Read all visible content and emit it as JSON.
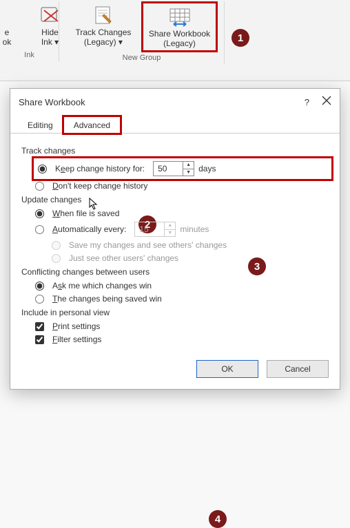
{
  "ribbon": {
    "groups": {
      "ink": {
        "label": "Ink",
        "btns": {
          "partial": {
            "line1": "e",
            "line2": "ok"
          },
          "hide_ink": {
            "line1": "Hide",
            "line2": "Ink ▾"
          }
        }
      },
      "newgroup": {
        "label": "New Group",
        "btns": {
          "track_changes": {
            "line1": "Track Changes",
            "line2": "(Legacy) ▾"
          },
          "share_wb": {
            "line1": "Share Workbook",
            "line2": "(Legacy)"
          }
        }
      }
    }
  },
  "dialog": {
    "title": "Share Workbook",
    "help": "?",
    "tabs": {
      "editing": "Editing",
      "advanced": "Advanced"
    },
    "track": {
      "title": "Track changes",
      "keep": {
        "pre": "K",
        "u": "e",
        "post": "ep change history for:"
      },
      "keep_value": "50",
      "days": "days",
      "dont": {
        "pre": "",
        "u": "D",
        "post": "on't keep change history"
      }
    },
    "update": {
      "title": "Update changes",
      "when": {
        "pre": "",
        "u": "W",
        "post": "hen file is saved"
      },
      "auto": {
        "pre": "",
        "u": "A",
        "post": "utomatically every:"
      },
      "auto_value": "15",
      "minutes": "minutes",
      "save_mine": "Save my changes and see others' changes",
      "just_see": "Just see other users' changes"
    },
    "conflict": {
      "title": "Conflicting changes between users",
      "ask": {
        "pre": "A",
        "u": "s",
        "post": "k me which changes win"
      },
      "being": {
        "pre": "",
        "u": "T",
        "post": "he changes being saved win"
      }
    },
    "include": {
      "title": "Include in personal view",
      "print": {
        "pre": "",
        "u": "P",
        "post": "rint settings"
      },
      "filter": {
        "pre": "",
        "u": "F",
        "post": "ilter settings"
      }
    },
    "buttons": {
      "ok": "OK",
      "cancel": "Cancel"
    }
  },
  "badges": {
    "b1": "1",
    "b2": "2",
    "b3": "3",
    "b4": "4"
  }
}
